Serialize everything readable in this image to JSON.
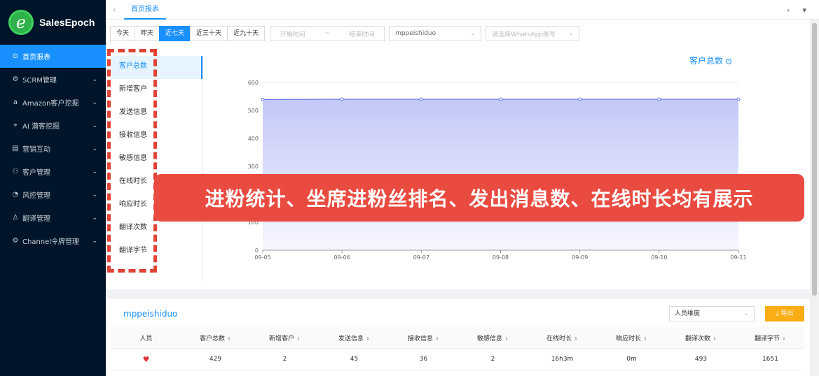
{
  "app": {
    "brand": "SalesEpoch",
    "logo_letter": "e"
  },
  "sidebar": {
    "items": [
      {
        "label": "首页报表",
        "icon": "home-icon",
        "glyph": "⊙",
        "active": true,
        "has_children": false
      },
      {
        "label": "SCRM管理",
        "icon": "gear-icon",
        "glyph": "⚙",
        "has_children": true
      },
      {
        "label": "Amazon客户挖掘",
        "icon": "amazon-icon",
        "glyph": "a",
        "has_children": true
      },
      {
        "label": "AI 潜客挖掘",
        "icon": "ai-icon",
        "glyph": "⌖",
        "has_children": true
      },
      {
        "label": "营销互动",
        "icon": "calendar-icon",
        "glyph": "▤",
        "has_children": true
      },
      {
        "label": "客户管理",
        "icon": "users-icon",
        "glyph": "⚇",
        "has_children": true
      },
      {
        "label": "风控管理",
        "icon": "risk-icon",
        "glyph": "◔",
        "has_children": true
      },
      {
        "label": "翻译管理",
        "icon": "user-icon",
        "glyph": "♙",
        "has_children": true
      },
      {
        "label": "Channel令牌管理",
        "icon": "token-icon",
        "glyph": "⚙",
        "has_children": true
      }
    ]
  },
  "topbar": {
    "tab": "首页报表",
    "left_arrow": "‹",
    "right_arrow": "›",
    "dropdown": "▾"
  },
  "filters": {
    "quick_ranges": [
      "今天",
      "昨天",
      "近七天",
      "近三十天",
      "近九十天"
    ],
    "active_range": "近七天",
    "start_placeholder": "开始时间",
    "range_sep": "~",
    "end_placeholder": "结束时间",
    "user_select": "mppeishiduo",
    "whatsapp_placeholder": "请选择WhatsApp账号"
  },
  "metrics": [
    "客户总数",
    "新增客户",
    "发送信息",
    "接收信息",
    "敏感信息",
    "在线时长",
    "响应时长",
    "翻译次数",
    "翻译字节"
  ],
  "active_metric": "客户总数",
  "chart_data": {
    "type": "area",
    "title": "客户总数",
    "x": [
      "09-05",
      "09-06",
      "09-07",
      "09-08",
      "09-09",
      "09-10",
      "09-11"
    ],
    "values": [
      539,
      540,
      540,
      540,
      540,
      540,
      540
    ],
    "ylim": [
      0,
      600
    ],
    "yticks": [
      0,
      100,
      200,
      300,
      400,
      500,
      600
    ],
    "grid": true,
    "color": "#6b78e5",
    "fill": "#c3c8f7"
  },
  "banner": {
    "text": "进粉统计、坐席进粉丝排名、发出消息数、在线时长均有展示"
  },
  "table": {
    "user": "mppeishiduo",
    "dimension": "人员维度",
    "export": "导出",
    "export_icon": "⤓",
    "columns": [
      "人员",
      "客户总数",
      "新增客户",
      "发送信息",
      "接收信息",
      "敏感信息",
      "在线时长",
      "响应时长",
      "翻译次数",
      "翻译字节"
    ],
    "rows": [
      {
        "person": "♥",
        "cells": [
          "429",
          "2",
          "45",
          "36",
          "2",
          "16h3m",
          "0m",
          "493",
          "1651"
        ]
      }
    ]
  },
  "colors": {
    "primary": "#1890ff",
    "sidebar_bg": "#001529",
    "banner": "#e94b40",
    "export": "#faad14"
  }
}
